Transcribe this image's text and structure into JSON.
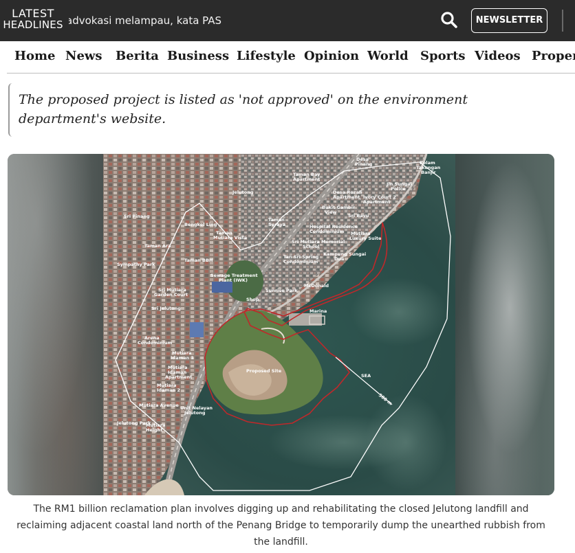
{
  "header": {
    "brand_line1": "LATEST",
    "brand_line2": "HEADLINES",
    "ticker_text": "advokasi melampau, kata PAS",
    "newsletter_label": "NEWSLETTER"
  },
  "nav": {
    "items": [
      "Home",
      "News",
      "Berita",
      "Business",
      "Lifestyle",
      "Opinion",
      "World",
      "Sports",
      "Videos",
      "Property"
    ]
  },
  "article": {
    "pullquote": "The proposed project is listed as 'not approved' on the environment department's website.",
    "figure": {
      "caption": "The RM1 billion reclamation plan involves digging up and rehabilitating the closed Jelutong landfill and reclaiming adjacent coastal land north of the Penang Bridge to temporarily dump the unearthed rubbish from the landfill.",
      "map_labels": [
        "Desa Pinang",
        "Kolam Takungan Banjir",
        "Kampung Jelutong",
        "Taman Bay Apartment",
        "Desa Rozafi Apartment",
        "Ivory Court 2 Apartment",
        "Jln Sungai Police",
        "Sri Pinang",
        "Bukit Gambir View",
        "Sri Bayu",
        "Bandar Jelutong",
        "Bengkel Ling",
        "Taman Seraya",
        "Hospital Residence Condominium",
        "Mutiara Luxury Suite",
        "Taman Mutiara Vista",
        "Taman Ara",
        "Sri Mutiara Memorial School",
        "Tan Sri Spring Condominium",
        "Kampung Sungai Dua",
        "Sympathy Park",
        "Taman BBH",
        "Sewage Treatment Plant (IWK)",
        "McDonald",
        "Shop",
        "Sunrise Park",
        "Sri Mutiara Garden Court",
        "Marina",
        "Sri Jelutong",
        "Arena Condominium",
        "Mutiara Idaman 1",
        "Mutiara Idaman Apartment",
        "Proposed Site",
        "Mutiara Idaman 2",
        "SEA",
        "Unit Nelayan Jelutong",
        "Mutiara Avenue",
        "Jelutong Park",
        "Mutiara Height",
        "500 m"
      ]
    }
  },
  "colors": {
    "topbar_bg": "#2b2b2b",
    "site_outline": "#c0282a",
    "buffer_outline": "#ffffff"
  }
}
